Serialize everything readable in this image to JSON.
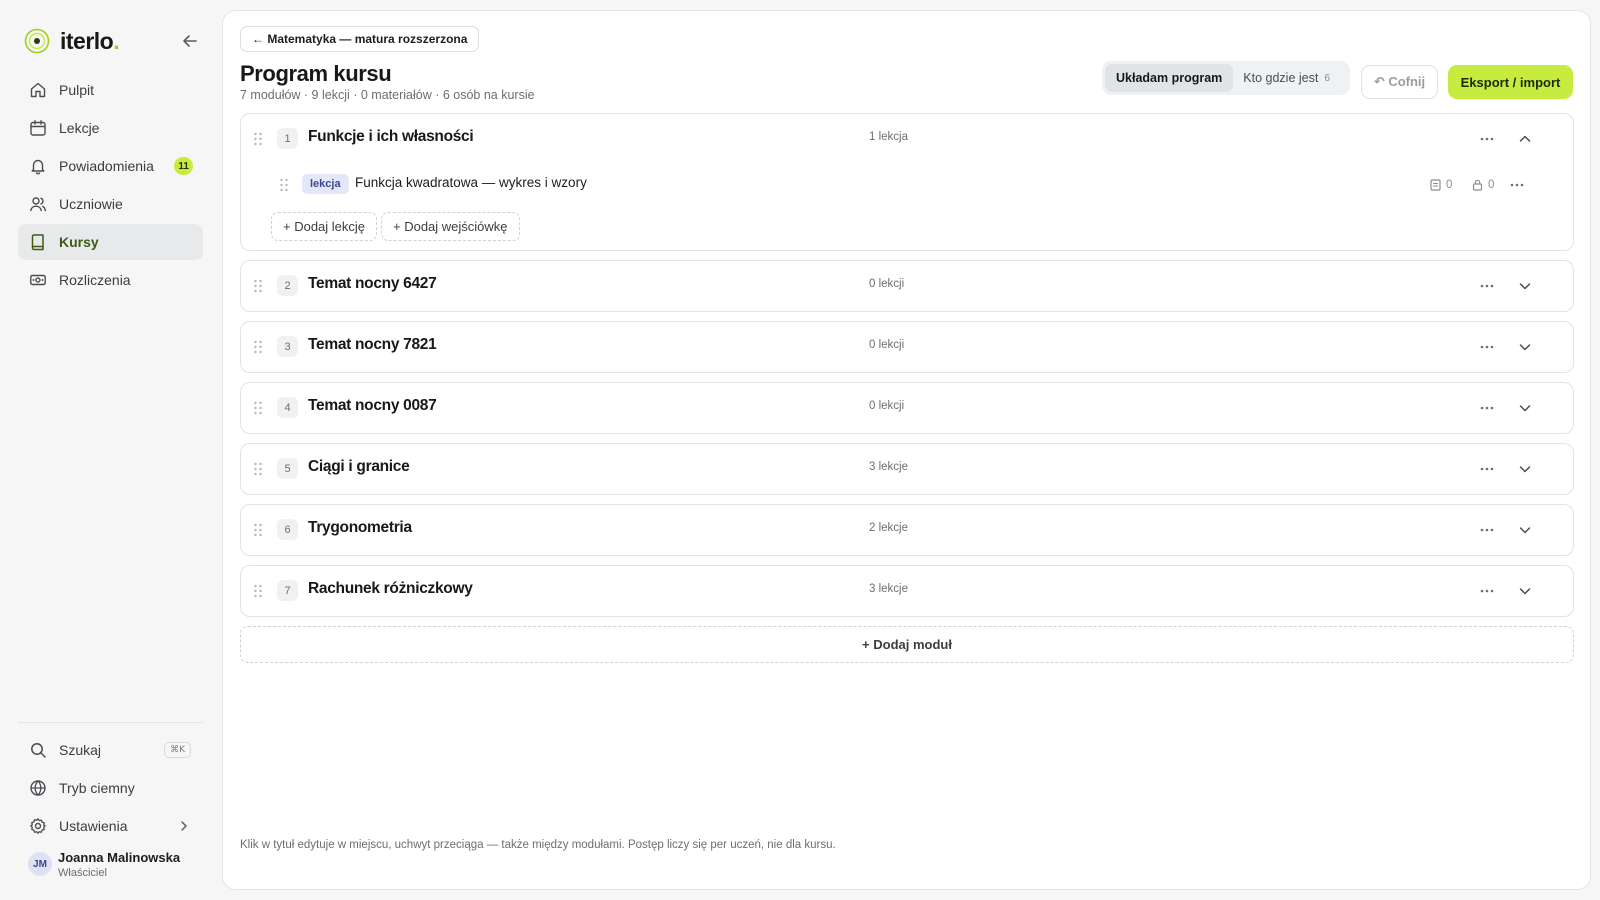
{
  "app": {
    "brand": "iterlo",
    "brand_dot": ".",
    "accent_color": "#c6ec3f"
  },
  "sidebar": {
    "collapse_icon": "arrow-left-icon",
    "items": [
      {
        "label": "Pulpit",
        "icon": "home-icon",
        "active": false
      },
      {
        "label": "Lekcje",
        "icon": "calendar-icon",
        "active": false
      },
      {
        "label": "Powiadomienia",
        "icon": "bell-icon",
        "active": false,
        "badge": "11"
      },
      {
        "label": "Uczniowie",
        "icon": "users-icon",
        "active": false
      },
      {
        "label": "Kursy",
        "icon": "book-icon",
        "active": true
      },
      {
        "label": "Rozliczenia",
        "icon": "banknote-icon",
        "active": false
      }
    ],
    "bottom_items": [
      {
        "label": "Szukaj",
        "icon": "search-icon",
        "shortcut": "⌘K"
      },
      {
        "label": "Tryb ciemny",
        "icon": "globe-icon"
      },
      {
        "label": "Ustawienia",
        "icon": "gear-icon"
      }
    ],
    "user": {
      "initials": "JM",
      "name": "Joanna Malinowska",
      "role": "Właściciel"
    }
  },
  "header": {
    "back_label": "← Matematyka — matura rozszerzona",
    "title": "Program kursu",
    "meta": "7 modułów · 9 lekcji · 0 materiałów · 6 osób na kursie",
    "segment": {
      "active_label": "Układam program",
      "inactive_label": "Kto gdzie jest",
      "inactive_count": "6"
    },
    "undo_label": "↶ Cofnij",
    "export_label": "Eksport / import"
  },
  "modules": [
    {
      "number": "1",
      "title": "Funkcje i ich własności",
      "count": "1 lekcja",
      "expanded": true,
      "lessons": [
        {
          "tag": "lekcja",
          "title": "Funkcja kwadratowa — wykres i wzory",
          "materials": "0",
          "locked": "0"
        }
      ],
      "add_lesson_label": "+ Dodaj lekcję",
      "add_quiz_label": "+ Dodaj wejściówkę"
    },
    {
      "number": "2",
      "title": "Temat nocny 6427",
      "count": "0 lekcji",
      "expanded": false
    },
    {
      "number": "3",
      "title": "Temat nocny 7821",
      "count": "0 lekcji",
      "expanded": false
    },
    {
      "number": "4",
      "title": "Temat nocny 0087",
      "count": "0 lekcji",
      "expanded": false
    },
    {
      "number": "5",
      "title": "Ciągi i granice",
      "count": "3 lekcje",
      "expanded": false
    },
    {
      "number": "6",
      "title": "Trygonometria",
      "count": "2 lekcje",
      "expanded": false
    },
    {
      "number": "7",
      "title": "Rachunek różniczkowy",
      "count": "3 lekcje",
      "expanded": false
    }
  ],
  "add_module_label": "+ Dodaj moduł",
  "footer_hint": "Klik w tytuł edytuje w miejscu, uchwyt przeciąga — także między modułami. Postęp liczy się per uczeń, nie dla kursu."
}
